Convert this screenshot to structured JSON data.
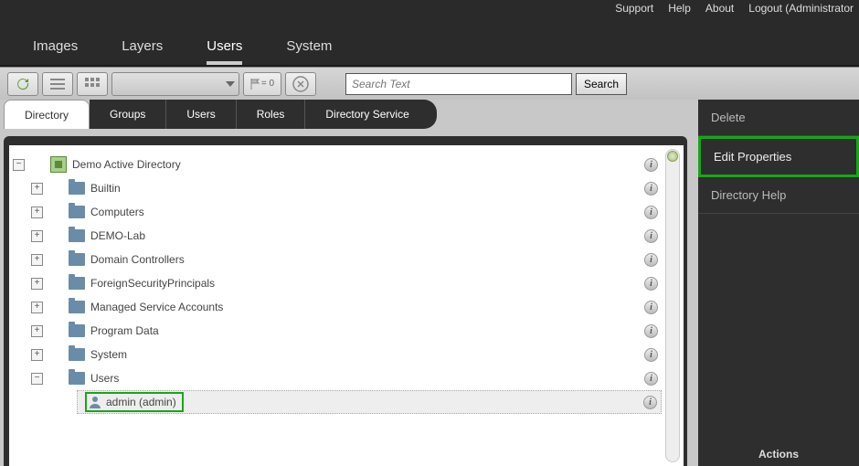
{
  "topbar": {
    "support": "Support",
    "help": "Help",
    "about": "About",
    "logout": "Logout (Administrator"
  },
  "mainnav": {
    "images": "Images",
    "layers": "Layers",
    "users": "Users",
    "system": "System"
  },
  "toolbar": {
    "flag_count": "= 0",
    "search_placeholder": "Search Text",
    "search_btn": "Search"
  },
  "subtabs": {
    "directory": "Directory",
    "groups": "Groups",
    "users": "Users",
    "roles": "Roles",
    "directory_service": "Directory Service"
  },
  "tree": {
    "root": "Demo Active Directory",
    "items": [
      "Builtin",
      "Computers",
      "DEMO-Lab",
      "Domain Controllers",
      "ForeignSecurityPrincipals",
      "Managed Service Accounts",
      "Program Data",
      "System",
      "Users"
    ],
    "selected_user": "admin (admin)"
  },
  "actions": {
    "delete": "Delete",
    "edit_properties": "Edit Properties",
    "directory_help": "Directory Help",
    "footer": "Actions"
  }
}
